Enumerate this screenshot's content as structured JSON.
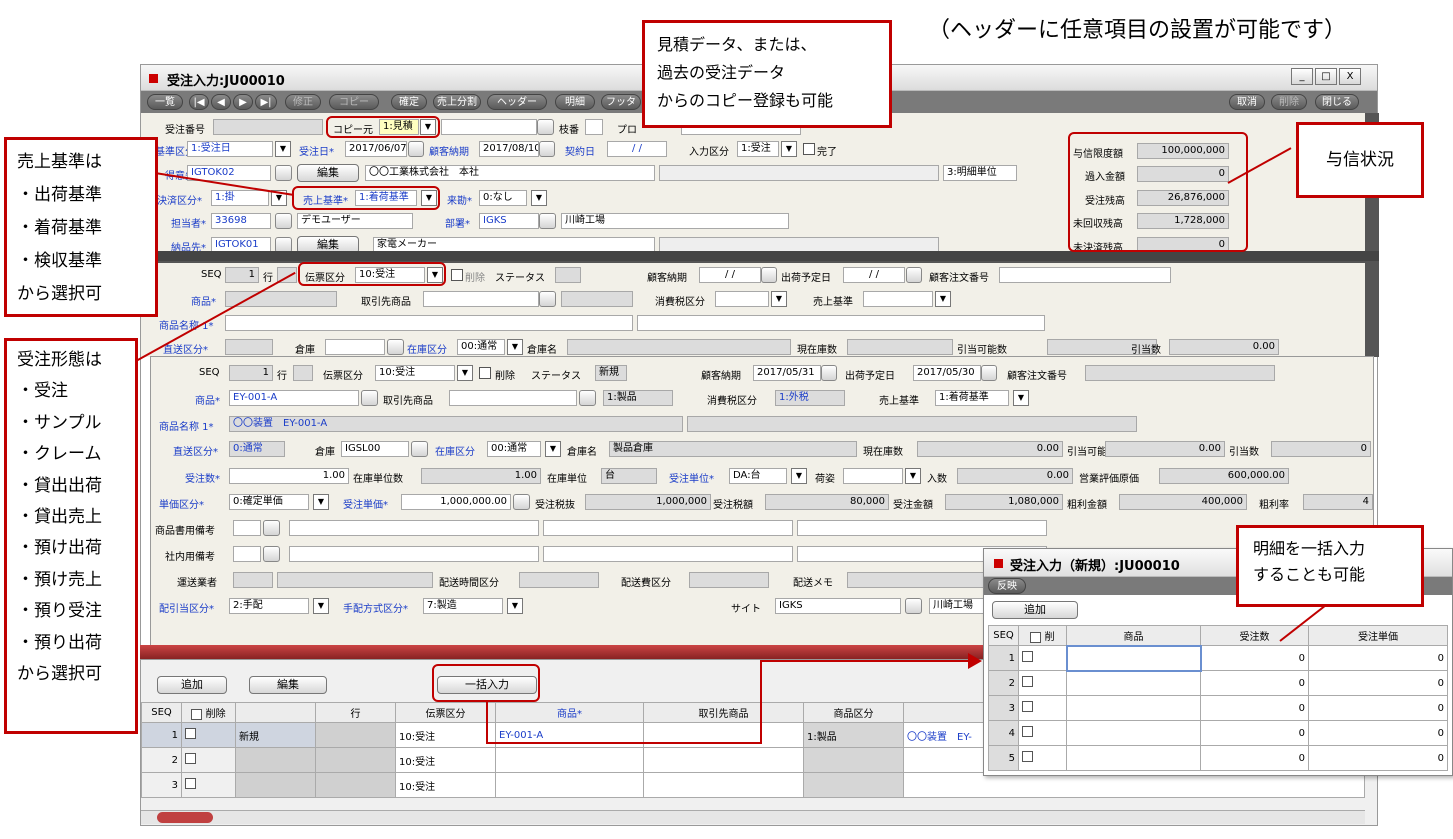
{
  "caption": "（ヘッダーに任意項目の設置が可能です）",
  "window": {
    "title": "受注入力:JU00010",
    "min": "_",
    "max": "□",
    "close": "X"
  },
  "toolbar": {
    "list": "一覧",
    "first": "|◀",
    "prev": "◀",
    "next": "▶",
    "last": "▶|",
    "modify": "修正",
    "copy": "コピー",
    "confirm": "確定",
    "sales_split": "売上分割",
    "header": "ヘッダー",
    "detail": "明細",
    "footer": "フッタ",
    "cancel": "取消",
    "delete": "削除",
    "close": "閉じる"
  },
  "header": {
    "order_no_label": "受注番号",
    "copy_source_label": "コピー元",
    "copy_source_value": "1:見積",
    "branch_label": "枝番",
    "project_label": "プロ",
    "sales_basis_kbn_label": "基準区分",
    "sales_basis_kbn_value": "1:受注日",
    "order_date_label": "受注日*",
    "order_date_value": "2017/06/07",
    "customer_due_label": "顧客納期",
    "customer_due_value": "2017/08/10",
    "contract_date_label": "契約日",
    "contract_date_value": "/ /",
    "input_kbn_label": "入力区分",
    "input_kbn_value": "1:受注",
    "complete_label": "完了",
    "customer_label": "得意先*",
    "customer_code": "IGTOK02",
    "edit": "編集",
    "customer_name": "〇〇工業株式会社　本社",
    "detail_unit": "3:明細単位",
    "settle_label": "決済区分*",
    "settle_value": "1:掛",
    "sales_basis_label": "売上基準*",
    "sales_basis_value": "1:着荷基準",
    "visit_label": "来勘*",
    "visit_value": "0:なし",
    "staff_label": "担当者*",
    "staff_code": "33698",
    "staff_name": "デモユーザー",
    "dept_label": "部署*",
    "dept_code": "IGKS",
    "dept_name": "川崎工場",
    "delivery_label": "納品先*",
    "delivery_code": "IGTOK01",
    "delivery_name": "家電メーカー",
    "credit_limit_label": "与信限度額",
    "credit_limit": "100,000,000",
    "overpay_label": "過入金額",
    "overpay": "0",
    "order_balance_label": "受注残高",
    "order_balance": "26,876,000",
    "uncollected_label": "未回収残高",
    "uncollected": "1,728,000",
    "unsettled_label": "未決済残高",
    "unsettled": "0"
  },
  "section2": {
    "seq_label": "SEQ",
    "seq": "1",
    "row_label": "行",
    "slip_kbn_label": "伝票区分",
    "slip_kbn": "10:受注",
    "delete_label": "削除",
    "status_label": "ステータス",
    "due_label": "顧客納期",
    "due": "/ /",
    "ship_label": "出荷予定日",
    "ship": "/ /",
    "cust_order_label": "顧客注文番号",
    "product_label": "商品*",
    "partner_product_label": "取引先商品",
    "tax_label": "消費税区分",
    "basis_label": "売上基準",
    "name1_label": "商品名称 1*",
    "direct_label": "直送区分*",
    "warehouse_label": "倉庫",
    "stock_kbn_label": "在庫区分",
    "stock_kbn": "00:通常",
    "warehouse_name_label": "倉庫名",
    "current_stock_label": "現在庫数",
    "available_label": "引当可能数",
    "allocated_label": "引当数",
    "allocated": "0.00"
  },
  "detail": {
    "seq_label": "SEQ",
    "seq": "1",
    "row_label": "行",
    "slip_kbn_label": "伝票区分",
    "slip_kbn": "10:受注",
    "delete_label": "削除",
    "status_label": "ステータス",
    "status": "新規",
    "due_label": "顧客納期",
    "due": "2017/05/31",
    "ship_label": "出荷予定日",
    "ship": "2017/05/30",
    "cust_order_label": "顧客注文番号",
    "product_label": "商品*",
    "product": "EY-001-A",
    "partner_product_label": "取引先商品",
    "product_kbn": "1:製品",
    "tax_label": "消費税区分",
    "tax": "1:外税",
    "basis_label": "売上基準",
    "basis": "1:着荷基準",
    "name1_label": "商品名称 1*",
    "name1": "〇〇装置　EY-001-A",
    "direct_label": "直送区分*",
    "direct": "0:通常",
    "warehouse_label": "倉庫",
    "warehouse": "IGSL00",
    "stock_kbn_label": "在庫区分",
    "stock_kbn": "00:通常",
    "warehouse_name_label": "倉庫名",
    "warehouse_name": "製品倉庫",
    "current_stock_label": "現在庫数",
    "current_stock": "0.00",
    "available_label": "引当可能数",
    "available": "0.00",
    "allocated_label": "引当数",
    "allocated": "0",
    "qty_label": "受注数*",
    "qty": "1.00",
    "stock_unit_qty_label": "在庫単位数",
    "stock_unit_qty": "1.00",
    "stock_unit_label": "在庫単位",
    "stock_unit": "台",
    "order_unit_label": "受注単位*",
    "order_unit": "DA:台",
    "packing_label": "荷姿",
    "pieces_label": "入数",
    "pieces": "0.00",
    "eval_cost_label": "営業評価原価",
    "eval_cost": "600,000.00",
    "price_kbn_label": "単価区分*",
    "price_kbn": "0:確定単価",
    "unit_price_label": "受注単価*",
    "unit_price": "1,000,000.00",
    "tax_excl_label": "受注税抜",
    "tax_excl": "1,000,000",
    "tax_amt_label": "受注税額",
    "tax_amt": "80,000",
    "amount_label": "受注金額",
    "amount": "1,080,000",
    "profit_label": "粗利金額",
    "profit": "400,000",
    "profit_rate_label": "粗利率",
    "profit_rate": "4",
    "note_label": "商品書用備考",
    "internal_note_label": "社内用備考",
    "carrier_label": "運送業者",
    "time_label": "配送時間区分",
    "fee_label": "配送費区分",
    "memo_label": "配送メモ",
    "alloc_kbn_label": "配引当区分*",
    "alloc_kbn": "2:手配",
    "arrange_label": "手配方式区分*",
    "arrange": "7:製造",
    "site_label": "サイト",
    "site": "IGKS",
    "site_name": "川崎工場"
  },
  "grid": {
    "add": "追加",
    "edit": "編集",
    "bulk": "一括入力",
    "headers": [
      "SEQ",
      "削除",
      "",
      "行",
      "伝票区分",
      "商品*",
      "取引先商品",
      "商品区分",
      ""
    ],
    "rows": [
      {
        "seq": "1",
        "status": "新規",
        "slip": "10:受注",
        "product": "EY-001-A",
        "kbn": "1:製品",
        "name": "〇〇装置　EY-"
      },
      {
        "seq": "2",
        "status": "",
        "slip": "10:受注",
        "product": "",
        "kbn": "",
        "name": ""
      },
      {
        "seq": "3",
        "status": "",
        "slip": "10:受注",
        "product": "",
        "kbn": "",
        "name": ""
      }
    ]
  },
  "popup": {
    "title": "受注入力（新規）:JU00010",
    "reflect": "反映",
    "add": "追加",
    "headers": [
      "SEQ",
      "削",
      "商品",
      "受注数",
      "受注単価"
    ],
    "rows": [
      {
        "seq": "1",
        "qty": "0",
        "price": "0"
      },
      {
        "seq": "2",
        "qty": "0",
        "price": "0"
      },
      {
        "seq": "3",
        "qty": "0",
        "price": "0"
      },
      {
        "seq": "4",
        "qty": "0",
        "price": "0"
      },
      {
        "seq": "5",
        "qty": "0",
        "price": "0"
      }
    ]
  },
  "callouts": {
    "copy": [
      "見積データ、または、",
      "過去の受注データ",
      "からのコピー登録も可能"
    ],
    "credit": "与信状況",
    "sales_basis": [
      "売上基準は",
      "・出荷基準",
      "・着荷基準",
      "・検収基準",
      "から選択可"
    ],
    "order_type": [
      "受注形態は",
      "・受注",
      "・サンプル",
      "・クレーム",
      "・貸出出荷",
      "・貸出売上",
      "・預け出荷",
      "・預け売上",
      "・預り受注",
      "・預り出荷",
      "から選択可"
    ],
    "bulk": [
      "明細を一括入力",
      "することも可能"
    ]
  },
  "colors": {
    "accent": "#c00000",
    "field_blue": "#1a3cc8",
    "panel": "#f2f0e8"
  }
}
